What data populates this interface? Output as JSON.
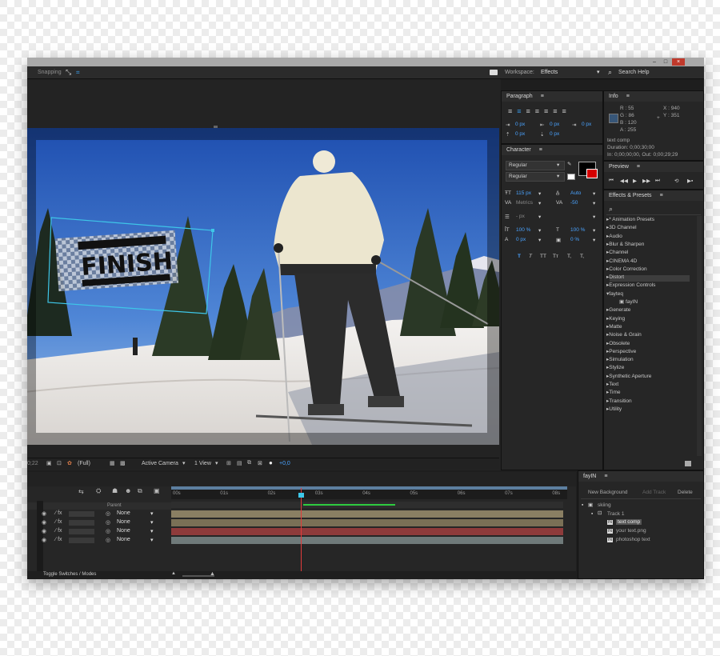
{
  "titlebar": {
    "min": "–",
    "max": "□",
    "close": "×"
  },
  "toolbar": {
    "snapping": "Snapping",
    "workspace_label": "Workspace:",
    "workspace_value": "Effects",
    "search_help": "Search Help"
  },
  "paragraph": {
    "title": "Paragraph",
    "indent_left": "0 px",
    "indent_mid": "0 px",
    "indent_right": "0 px",
    "space_before": "0 px",
    "space_after": "0 px"
  },
  "character": {
    "title": "Character",
    "font_family": "Regular",
    "font_style": "Regular",
    "size": "115 px",
    "leading": "Auto",
    "kerning": "Metrics",
    "tracking": "-50",
    "stroke": "- px",
    "vscale": "100 %",
    "hscale": "100 %",
    "baseline": "0 px",
    "tsume": "0 %",
    "styles": [
      "T",
      "T",
      "TT",
      "Tт",
      "T,",
      "T,"
    ]
  },
  "info": {
    "title": "Info",
    "r": "R : 55",
    "g": "G : 86",
    "b": "B : 120",
    "a": "A : 255",
    "x": "X : 940",
    "y": "Y : 351",
    "comp_name": "text comp",
    "duration": "Duration: 0;00;30;00",
    "inout": "In: 0;00;00;00, Out: 0;00;29;29"
  },
  "preview": {
    "title": "Preview"
  },
  "effects": {
    "title": "Effects & Presets",
    "items": [
      "* Animation Presets",
      "3D Channel",
      "Audio",
      "Blur & Sharpen",
      "Channel",
      "CINEMA 4D",
      "Color Correction",
      "Distort",
      "Expression Controls",
      "fayteq",
      "fayIN",
      "Generate",
      "Keying",
      "Matte",
      "Noise & Grain",
      "Obsolete",
      "Perspective",
      "Simulation",
      "Stylize",
      "Synthetic Aperture",
      "Text",
      "Time",
      "Transition",
      "Utility"
    ]
  },
  "viewer": {
    "finish_text": "FINISH",
    "timecode": "0;22",
    "resolution": "(Full)",
    "camera": "Active Camera",
    "views": "1 View",
    "exposure": "+0,0"
  },
  "timeline": {
    "parent_header": "Parent",
    "rows": [
      {
        "parent": "None"
      },
      {
        "parent": "None"
      },
      {
        "parent": "None"
      },
      {
        "parent": "None"
      }
    ],
    "ticks": [
      "00s",
      "01s",
      "02s",
      "03s",
      "04s",
      "05s",
      "06s",
      "07s",
      "08s"
    ],
    "footer": "Toggle Switches / Modes"
  },
  "fayin": {
    "title": "fayIN",
    "new_background": "New Background",
    "add_track": "Add Track",
    "delete": "Delete",
    "tree": [
      "skiing",
      "Track 1",
      "text comp",
      "your text.png",
      "photoshop text"
    ],
    "badge": "IN"
  },
  "colors": {
    "accent": "#2d8ceb",
    "selected_blue": "#2f7fd0",
    "bar_tan": "#8a7f63",
    "bar_red": "#8e3b3b",
    "bar_gray": "#6f7a7a"
  }
}
